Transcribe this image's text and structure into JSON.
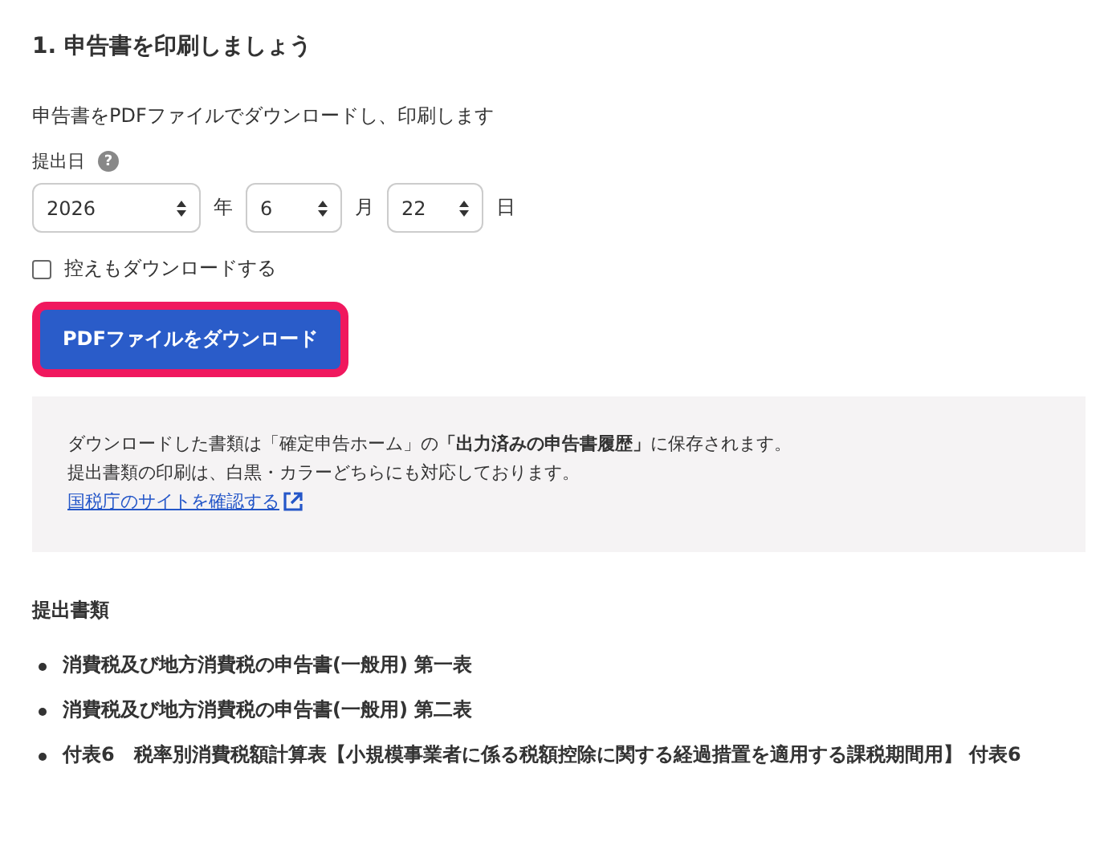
{
  "heading": "1. 申告書を印刷しましょう",
  "intro": "申告書をPDFファイルでダウンロードし、印刷します",
  "date": {
    "label": "提出日",
    "help": "?",
    "fields": [
      {
        "value": "2026",
        "unit": "年",
        "kind": "wide"
      },
      {
        "value": "6",
        "unit": "月",
        "kind": "narrow"
      },
      {
        "value": "22",
        "unit": "日",
        "kind": "narrow"
      }
    ]
  },
  "copy_checkbox": {
    "label": "控えもダウンロードする",
    "checked": false
  },
  "download_button": {
    "label": "PDFファイルをダウンロード",
    "focused": true
  },
  "note": {
    "lines": [
      "ダウンロードした書類は「確定申告ホーム」の**「出力済みの申告書履歴」**に保存されます。",
      "提出書類の印刷は、白黒・カラーどちらにも対応しております。"
    ],
    "link": "国税庁のサイトを確認する"
  },
  "documents": {
    "title": "提出書類",
    "items": [
      "消費税及び地方消費税の申告書(一般用) 第一表",
      "消費税及び地方消費税の申告書(一般用) 第二表",
      "付表6　税率別消費税額計算表【小規模事業者に係る税額控除に関する経過措置を適用する課税期間用】 付表6"
    ]
  }
}
